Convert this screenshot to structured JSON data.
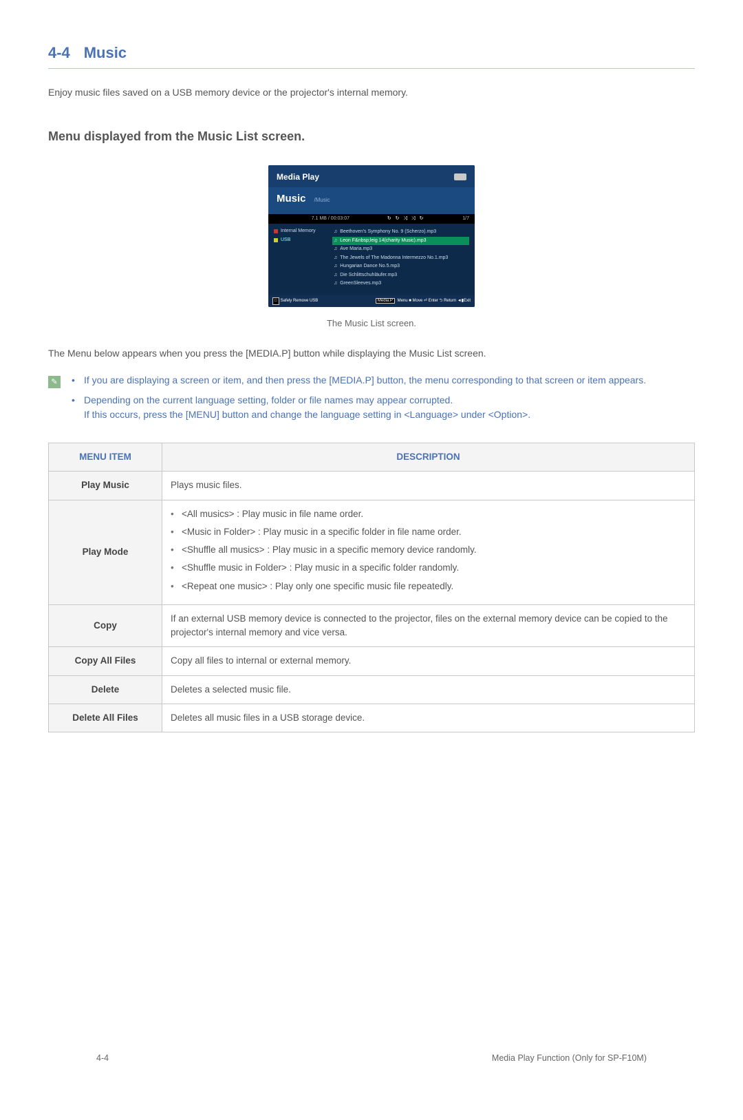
{
  "section": {
    "num": "4-4",
    "title": "Music"
  },
  "intro": "Enjoy music files saved on a USB memory device or the projector's internal memory.",
  "subheading": "Menu displayed from the Music List screen.",
  "screenshot": {
    "header": "Media Play",
    "mode": "Music",
    "path": "/Music",
    "info_left": "",
    "info_mid": "7.1 MB / 00:03:07",
    "info_icons": "↻ ↻ ⤨ ⤨ ↻",
    "info_right": "1/7",
    "left_items": [
      "Internal Memory",
      "USB"
    ],
    "files": [
      "Beethoven's Symphony No. 9 (Scherzo).mp3",
      "Leon F&nbsp;leig 14(charity Music).mp3",
      "Ave Maria.mp3",
      "The Jewels of The Madonna Intermezzo No.1.mp3",
      "Hungarian Dance No.5.mp3",
      "Die Schlittschuhläufer.mp3",
      "GreenSleeves.mp3"
    ],
    "selected_index": 1,
    "foot_left_btn": "□",
    "foot_left": "Safely Remove USB",
    "foot_right_pre": "Media.P",
    "foot_right": " Menu  ■ Move  ⏎ Enter  ⮌ Return  ◄▮Exit"
  },
  "caption": "The Music List screen.",
  "body_after": "The Menu below appears when you press the [MEDIA.P] button while displaying the Music List screen.",
  "notes": [
    "If you are displaying a screen or item, and then press the [MEDIA.P] button, the menu corresponding to that screen or item appears.",
    "Depending on the current language setting, folder or file names may appear corrupted.\nIf this occurs, press the [MENU] button and change the language setting in <Language> under <Option>."
  ],
  "table": {
    "headers": [
      "MENU ITEM",
      "DESCRIPTION"
    ],
    "rows": [
      {
        "item": "Play Music",
        "desc_text": "Plays music files."
      },
      {
        "item": "Play Mode",
        "opts": [
          "<All musics> : Play music in file name order.",
          "<Music in Folder> : Play music in a specific folder in file name order.",
          "<Shuffle all musics> : Play music in a specific memory device randomly.",
          "<Shuffle music in Folder> : Play music in a specific folder randomly.",
          "<Repeat one music> : Play only one specific music file repeatedly."
        ]
      },
      {
        "item": "Copy",
        "desc_text": "If an external USB memory device is connected to the projector, files on the external memory device can be copied to the projector's internal memory and vice versa."
      },
      {
        "item": "Copy All Files",
        "desc_text": "Copy all files to internal or external memory."
      },
      {
        "item": "Delete",
        "desc_text": "Deletes a selected music file."
      },
      {
        "item": "Delete All Files",
        "desc_text": "Deletes all music files in a USB storage device."
      }
    ]
  },
  "footer": {
    "left": "4-4",
    "right": "Media Play Function (Only for SP-F10M)"
  }
}
